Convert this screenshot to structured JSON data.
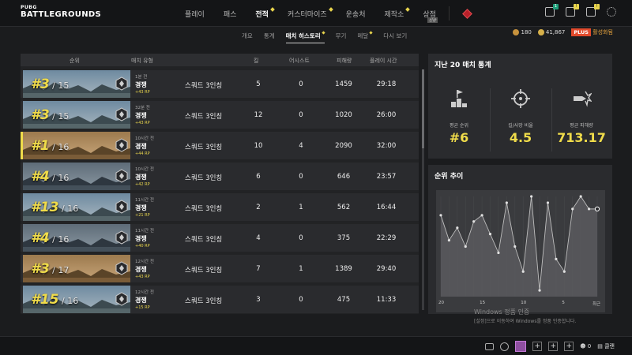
{
  "app": {
    "logo_small": "PUBG",
    "logo_big": "BATTLEGROUNDS"
  },
  "nav": {
    "items": [
      {
        "label": "플레이",
        "active": false,
        "dot": false
      },
      {
        "label": "패스",
        "active": false,
        "dot": false
      },
      {
        "label": "전적",
        "active": true,
        "dot": true
      },
      {
        "label": "커스터마이즈",
        "active": false,
        "dot": true
      },
      {
        "label": "운송처",
        "active": false,
        "dot": false
      },
      {
        "label": "제작소",
        "active": false,
        "dot": true
      },
      {
        "label": "상점",
        "active": false,
        "dot": false
      }
    ],
    "shop_tag": "신상"
  },
  "top_icons": {
    "badge1": "1",
    "badge2": "!",
    "badge3": "!"
  },
  "subnav": {
    "items": [
      {
        "label": "개요",
        "active": false
      },
      {
        "label": "통계",
        "active": false
      },
      {
        "label": "매치 히스토리",
        "active": true
      },
      {
        "label": "무기",
        "active": false
      },
      {
        "label": "메달",
        "active": false
      },
      {
        "label": "다시 보기",
        "active": false
      }
    ]
  },
  "currency": {
    "bp": "180",
    "gcoin": "41,867",
    "plus_label": "PLUS",
    "active_label": "활성화됨"
  },
  "table": {
    "headers": {
      "rank": "순위",
      "match_type": "매치 유형",
      "kills": "킬",
      "assists": "어시스트",
      "damage": "피해량",
      "playtime": "플레이 시간"
    },
    "rows": [
      {
        "rank": "#3",
        "total": " / 15",
        "time": "1분 전",
        "mode": "경쟁",
        "rp": "+43 RP",
        "squad": "스쿼드 3인칭",
        "kills": "5",
        "assists": "0",
        "damage": "1459",
        "playtime": "29:18",
        "map": "mountain"
      },
      {
        "rank": "#3",
        "total": " / 15",
        "time": "32분 전",
        "mode": "경쟁",
        "rp": "+43 RP",
        "squad": "스쿼드 3인칭",
        "kills": "12",
        "assists": "0",
        "damage": "1020",
        "playtime": "26:00",
        "map": "mountain"
      },
      {
        "rank": "#1",
        "total": " / 16",
        "time": "10시간 전",
        "mode": "경쟁",
        "rp": "+44 RP",
        "squad": "스쿼드 3인칭",
        "kills": "10",
        "assists": "4",
        "damage": "2090",
        "playtime": "32:00",
        "map": "desert"
      },
      {
        "rank": "#4",
        "total": " / 16",
        "time": "10시간 전",
        "mode": "경쟁",
        "rp": "+42 RP",
        "squad": "스쿼드 3인칭",
        "kills": "6",
        "assists": "0",
        "damage": "646",
        "playtime": "23:57",
        "map": "city"
      },
      {
        "rank": "#13",
        "total": " / 16",
        "time": "11시간 전",
        "mode": "경쟁",
        "rp": "+21 RP",
        "squad": "스쿼드 3인칭",
        "kills": "2",
        "assists": "1",
        "damage": "562",
        "playtime": "16:44",
        "map": "mountain"
      },
      {
        "rank": "#4",
        "total": " / 16",
        "time": "11시간 전",
        "mode": "경쟁",
        "rp": "+40 RP",
        "squad": "스쿼드 3인칭",
        "kills": "4",
        "assists": "0",
        "damage": "375",
        "playtime": "22:29",
        "map": "city"
      },
      {
        "rank": "#3",
        "total": " / 17",
        "time": "12시간 전",
        "mode": "경쟁",
        "rp": "+43 RP",
        "squad": "스쿼드 3인칭",
        "kills": "7",
        "assists": "1",
        "damage": "1389",
        "playtime": "29:40",
        "map": "desert"
      },
      {
        "rank": "#15",
        "total": " / 16",
        "time": "12시간 전",
        "mode": "경쟁",
        "rp": "+15 RP",
        "squad": "스쿼드 3인칭",
        "kills": "3",
        "assists": "0",
        "damage": "475",
        "playtime": "11:33",
        "map": "mountain"
      }
    ]
  },
  "stats": {
    "title": "지난 20 매치 통계",
    "items": [
      {
        "label": "평균 순위",
        "value": "#6",
        "icon": "podium-icon"
      },
      {
        "label": "킬/사망 비율",
        "value": "4.5",
        "icon": "crosshair-icon"
      },
      {
        "label": "평균 피해량",
        "value": "713.17",
        "icon": "bullet-impact-icon"
      }
    ]
  },
  "trend": {
    "title": "순위 추이"
  },
  "chart_data": {
    "type": "area",
    "title": "순위 추이",
    "x_tick_labels": [
      "20",
      "15",
      "10",
      "5",
      "최근"
    ],
    "x": [
      20,
      19,
      18,
      17,
      16,
      15,
      14,
      13,
      12,
      11,
      10,
      9,
      8,
      7,
      6,
      5,
      4,
      3,
      2,
      1
    ],
    "values": [
      4,
      8,
      6,
      9,
      5,
      4,
      7,
      10,
      2,
      9,
      13,
      1,
      16,
      2,
      11,
      13,
      3,
      1,
      3,
      3
    ],
    "ylim": [
      1,
      17
    ],
    "y_inverted": true,
    "grid": true
  },
  "watermark": {
    "line1": "Windows 정품 인증",
    "line2": "[설정]으로 이동하여 Windows를 정품 인증합니다."
  },
  "bottom": {
    "friends_count": "0",
    "clan_label": "클랜"
  },
  "colors": {
    "accent": "#f0dc4a",
    "panel": "#2a2b2e",
    "background": "#1b1c1e"
  }
}
